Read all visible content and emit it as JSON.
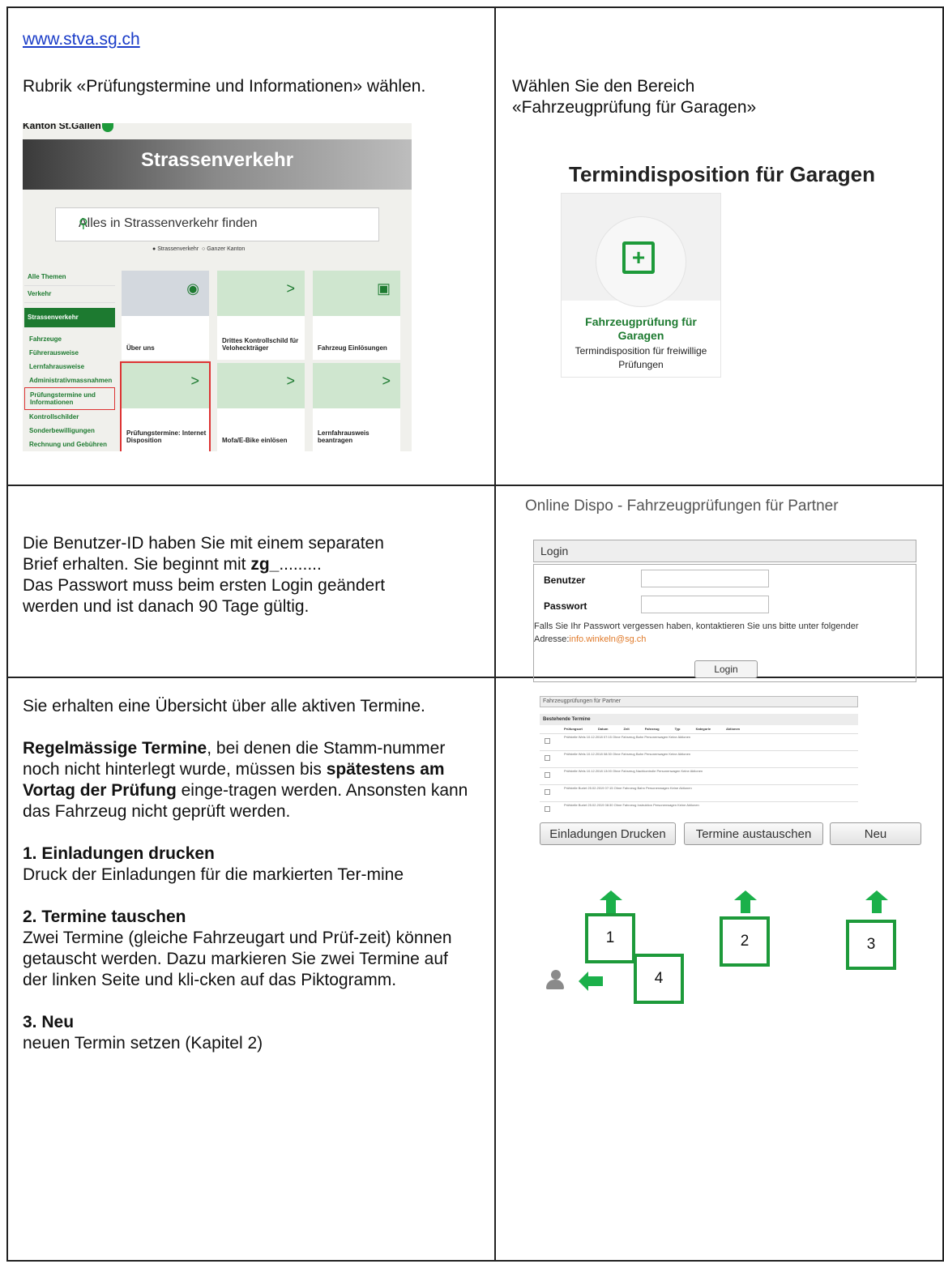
{
  "cell1": {
    "link": "www.stva.sg.ch",
    "instruction": "Rubrik «Prüfungstermine und Informationen» wählen.",
    "site": {
      "kanton": "Kanton St.Gallen",
      "hero": "Strassenverkehr",
      "search_placeholder": "Alles in Strassenverkehr finden",
      "radio1": "Strassenverkehr",
      "radio2": "Ganzer Kanton",
      "nav_top": [
        "Alle Themen",
        "Verkehr"
      ],
      "nav_active": "Strassenverkehr",
      "nav_sub": [
        "Fahrzeuge",
        "Führerausweise",
        "Lernfahrausweise",
        "Administrativmassnahmen",
        "Prüfungstermine und Informationen",
        "Kontrollschilder",
        "Sonderbewilligungen",
        "Rechnung und Gebühren"
      ],
      "tiles": [
        "Über uns",
        "Drittes Kontrollschild für Veloheckträger",
        "Fahrzeug Einlösungen",
        "Prüfungstermine: Internet Disposition",
        "Mofa/E-Bike einlösen",
        "Lernfahrausweis beantragen"
      ]
    }
  },
  "cell2": {
    "instruction_line1": "Wählen Sie den Bereich",
    "instruction_line2": "«Fahrzeugprüfung für Garagen»",
    "heading": "Termindisposition für Garagen",
    "card_title": "Fahrzeugprüfung für Garagen",
    "card_sub": "Termindisposition für freiwillige Prüfungen"
  },
  "cell3": {
    "line1": "Die Benutzer-ID haben Sie mit einem separaten",
    "line2_a": "Brief erhalten. Sie beginnt mit ",
    "line2_b": "zg_",
    "line2_c": ".........",
    "line3": "Das Passwort muss beim ersten Login geändert",
    "line4": "werden und ist danach 90 Tage gültig."
  },
  "cell4": {
    "heading": "Online Dispo - Fahrzeugprüfungen für Partner",
    "login_bar": "Login",
    "user_label": "Benutzer",
    "pass_label": "Passwort",
    "note": "Falls Sie Ihr Passwort vergessen haben, kontaktieren Sie uns bitte unter folgender",
    "note2": "Adresse:",
    "email": "info.winkeln@sg.ch",
    "button": "Login"
  },
  "cell5": {
    "p1": "Sie erhalten eine Übersicht über alle aktiven Termine.",
    "p2_bold1": "Regelmässige Termine",
    "p2_a": ", bei denen die Stamm-nummer noch nicht hinterlegt wurde, müssen bis ",
    "p2_bold2": "spätestens am Vortag der Prüfung",
    "p2_b": " einge-tragen werden. Ansonsten kann das Fahrzeug nicht geprüft werden.",
    "h1": "1.  Einladungen drucken",
    "t1": "Druck der Einladungen für die markierten Ter-mine",
    "h2": "2.  Termine tauschen",
    "t2": "Zwei Termine (gleiche Fahrzeugart und Prüf-zeit) können getauscht werden. Dazu markieren Sie zwei Termine auf der linken Seite und kli-cken auf das Piktogramm.",
    "h3": "3.  Neu",
    "t3": "neuen Termin setzen (Kapitel 2)"
  },
  "cell6": {
    "mini_bar": "Fahrzeugprüfungen für Partner",
    "mini_title": "Bestehende Termine",
    "mini_header": "Prüfungsort Datum Zeit Fahrzeug Typ Kategorie Aktionen",
    "mini_rows": [
      "Prüfstelle Wels  10.12.2018  07:15  Ohne Fahrzeug  Bahn  Personenwagen  Keine Aktionen",
      "Prüfstelle Wels  10.12.2018  08:30  Ohne Fahrzeug  Bahn  Personenwagen  Keine Aktionen",
      "Prüfstelle Wels  10.12.2018  13:00  Ohne Fahrzeug  Nachkontrolle  Personenwagen  Keine Aktionen",
      "Prüfstelle Buriet  25.02.2019  07:15  Ohne Fahrzeug  Bahn  Personenwagen  Keine Aktionen",
      "Prüfstelle Buriet  25.02.2019  08:30  Ohne Fahrzeug  Instruktion  Personenwagen  Keine Aktionen"
    ],
    "btn1": "Einladungen Drucken",
    "btn2": "Termine austauschen",
    "btn3": "Neu",
    "n1": "1",
    "n2": "2",
    "n3": "3",
    "n4": "4"
  },
  "colors": {
    "green": "#1d9a3a",
    "link": "#1a3cc8",
    "accent_email": "#e07a2a"
  }
}
